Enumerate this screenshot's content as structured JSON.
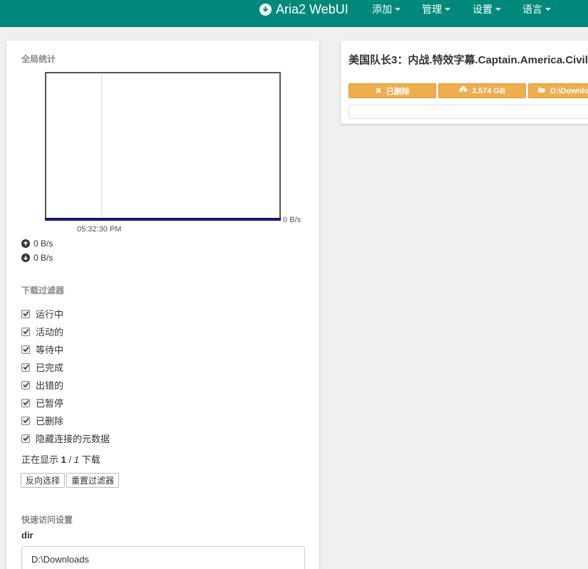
{
  "navbar": {
    "brand": "Aria2 WebUI",
    "menu": [
      {
        "label": "添加"
      },
      {
        "label": "管理"
      },
      {
        "label": "设置"
      },
      {
        "label": "语言"
      }
    ]
  },
  "stats": {
    "title": "全局统计",
    "chart_time": "05:32:30 PM",
    "chart_rate": "0 B/s",
    "upload": "0 B/s",
    "download": "0 B/s"
  },
  "filters": {
    "title": "下载过滤器",
    "items": [
      {
        "label": "运行中",
        "checked": true
      },
      {
        "label": "活动的",
        "checked": true
      },
      {
        "label": "等待中",
        "checked": true
      },
      {
        "label": "已完成",
        "checked": true
      },
      {
        "label": "出错的",
        "checked": true
      },
      {
        "label": "已暂停",
        "checked": true
      },
      {
        "label": "已删除",
        "checked": true
      },
      {
        "label": "隐藏连接的元数据",
        "checked": true
      }
    ],
    "showing_prefix": "正在显示",
    "showing_current": "1",
    "showing_sep": " / ",
    "showing_total": "1",
    "showing_suffix": "下载",
    "invert_button": "反向选择",
    "reset_button": "重置过滤器"
  },
  "quick_settings": {
    "title": "快速访问设置",
    "dir_label": "dir",
    "dir_value": "D:\\Downloads"
  },
  "download": {
    "title": "美国队长3：内战.特效字幕.Captain.America.Civil",
    "status": "已删除",
    "size": "3.574 GB",
    "path": "D:\\Downloads",
    "badge_color": "#f0ad4e"
  },
  "colors": {
    "navbar": "#00897b",
    "accent": "#f0ad4e"
  }
}
